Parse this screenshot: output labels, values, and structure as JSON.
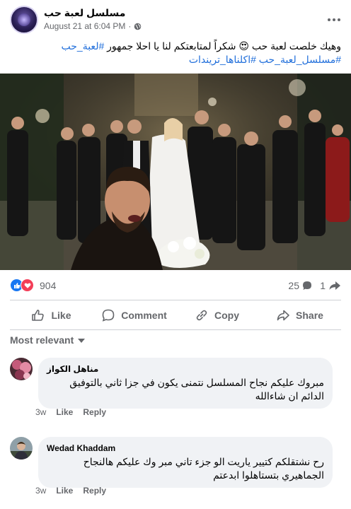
{
  "post": {
    "page_name": "مسلسل لعبة حب",
    "timestamp": "August 21 at 6:04 PM",
    "separator": "·",
    "text_line1": "وهيك خلصت لعبة حب 😍 شكراً لمتابعتكم لنا يا احلا جمهور",
    "hashtag1": "#لعبة_حب",
    "hashtag2": "#مسلسل_لعبة_حب",
    "hashtag3": "#اكلناها_تريندات",
    "icons": {
      "globe": "globe-icon",
      "more": "more-options-icon"
    }
  },
  "stats": {
    "reactions": "904",
    "comments": "25",
    "shares": "1",
    "icons": {
      "like": "like-reaction-icon",
      "love": "love-reaction-icon",
      "comment": "comment-bubble-icon",
      "share": "share-arrow-icon"
    }
  },
  "actions": {
    "like_label": "Like",
    "comment_label": "Comment",
    "copy_label": "Copy",
    "share_label": "Share"
  },
  "filter": {
    "label": "Most relevant"
  },
  "comments": [
    {
      "author": "مناهل الكواز",
      "text": "مبروك عليكم نجاح المسلسل نتمنى يكون في جزا ثاني بالتوفيق الدائم ان شاءالله",
      "time": "3w",
      "like": "Like",
      "reply": "Reply"
    },
    {
      "author": "Wedad Khaddam",
      "text": "رح نشتقلكم كتيير ياريت الو جزء تاني مبر وك عليكم هالنجاح الجماهيري بتستاهلوا ابدعتم",
      "time": "3w",
      "like": "Like",
      "reply": "Reply"
    }
  ],
  "colors": {
    "accent": "#1877f2",
    "love": "#f33e58",
    "hashtag": "#216fdb",
    "muted": "#65676b",
    "bubble": "#f0f2f5"
  }
}
